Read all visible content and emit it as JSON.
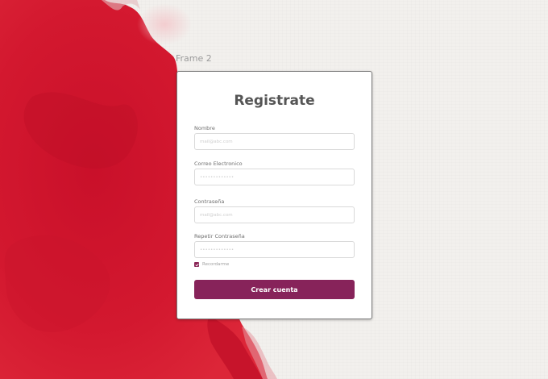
{
  "frame_label": "Frame 2",
  "form": {
    "title": "Registrate",
    "fields": [
      {
        "label": "Nombre",
        "placeholder": "mail@abc.com",
        "type": "text"
      },
      {
        "label": "Correo Electronico",
        "placeholder": "•••••••••••••",
        "type": "text"
      },
      {
        "label": "Contraseña",
        "placeholder": "mail@abc.com",
        "type": "text"
      },
      {
        "label": "Repetir Contraseña",
        "placeholder": "•••••••••••••",
        "type": "text"
      }
    ],
    "remember_label": "Recordarme",
    "remember_checked": true,
    "submit_label": "Crear cuenta"
  },
  "colors": {
    "accent": "#87235a",
    "paint": "#d2172f",
    "paper": "#f2f0ed"
  }
}
